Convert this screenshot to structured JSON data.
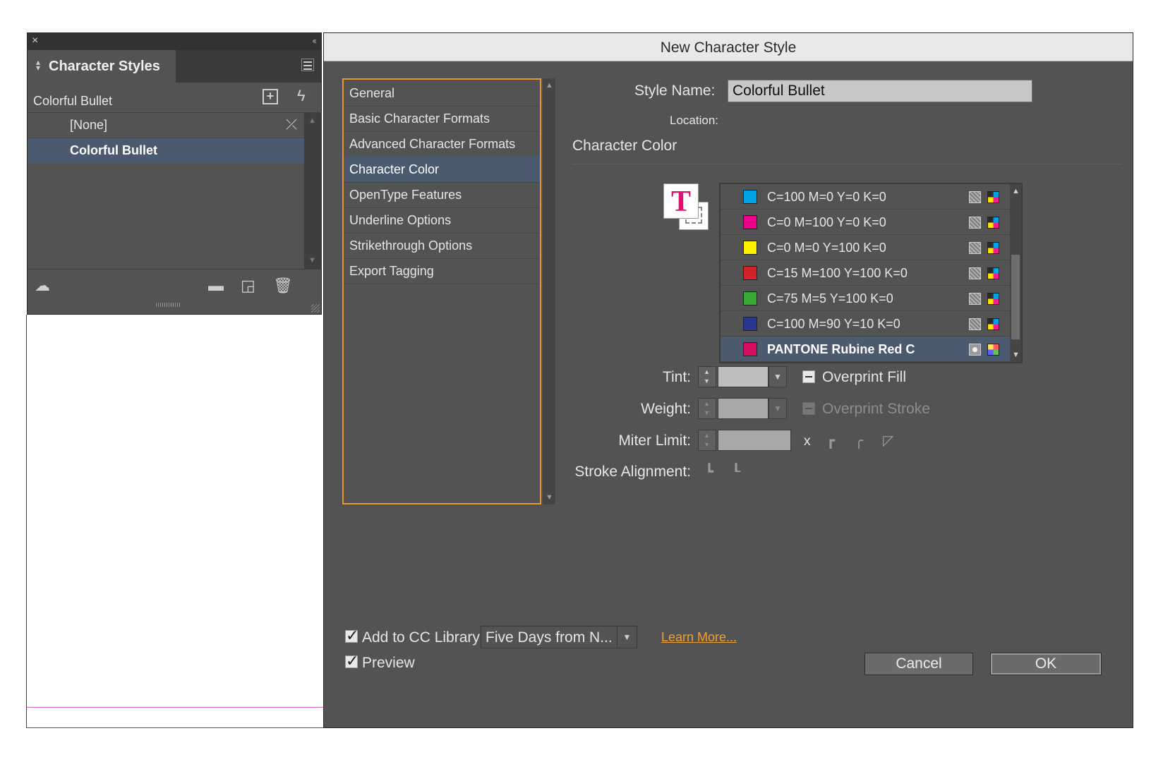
{
  "panel": {
    "tab_title": "Character Styles",
    "current_style": "Colorful Bullet",
    "styles": [
      "[None]",
      "Colorful Bullet"
    ],
    "selected_style_index": 1
  },
  "dialog": {
    "title": "New Character Style",
    "categories": [
      "General",
      "Basic Character Formats",
      "Advanced Character Formats",
      "Character Color",
      "OpenType Features",
      "Underline Options",
      "Strikethrough Options",
      "Export Tagging"
    ],
    "selected_category_index": 3,
    "style_name_label": "Style Name:",
    "style_name_value": "Colorful Bullet",
    "location_label": "Location:",
    "section_title": "Character Color",
    "swatches": [
      {
        "name": "C=100 M=0 Y=0 K=0",
        "color": "#00a3e8",
        "type": "process"
      },
      {
        "name": "C=0 M=100 Y=0 K=0",
        "color": "#ec008c",
        "type": "process"
      },
      {
        "name": "C=0 M=0 Y=100 K=0",
        "color": "#fff200",
        "type": "process"
      },
      {
        "name": "C=15 M=100 Y=100 K=0",
        "color": "#d2232a",
        "type": "process"
      },
      {
        "name": "C=75 M=5 Y=100 K=0",
        "color": "#3aaa35",
        "type": "process"
      },
      {
        "name": "C=100 M=90 Y=10 K=0",
        "color": "#27378f",
        "type": "process"
      },
      {
        "name": "PANTONE Rubine Red C",
        "color": "#d50f5d",
        "type": "spot"
      }
    ],
    "selected_swatch_index": 6,
    "tint_label": "Tint:",
    "overprint_fill_label": "Overprint Fill",
    "weight_label": "Weight:",
    "overprint_stroke_label": "Overprint Stroke",
    "miter_limit_label": "Miter Limit:",
    "miter_x": "x",
    "stroke_alignment_label": "Stroke Alignment:",
    "add_cc_library_label": "Add to CC Library:",
    "cc_library_value": "Five Days from N...",
    "learn_more": "Learn More...",
    "preview_label": "Preview",
    "cancel_label": "Cancel",
    "ok_label": "OK"
  },
  "colors": {
    "selection": "#4c5a70",
    "focus_ring": "#e8962f",
    "link": "#f0a030",
    "fill_icon_T": "#e0106e"
  }
}
